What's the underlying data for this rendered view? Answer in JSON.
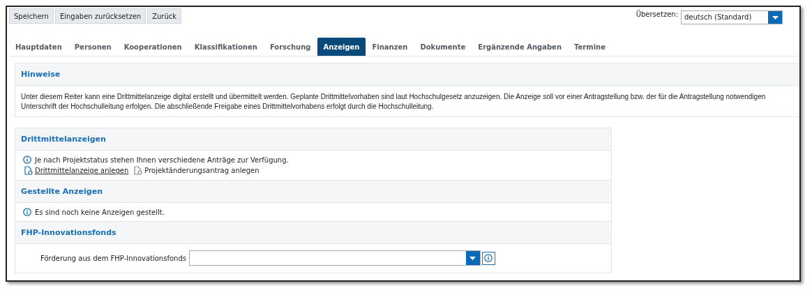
{
  "toolbar": {
    "buttons": [
      "Speichern",
      "Eingaben zurücksetzen",
      "Zurück"
    ]
  },
  "translate": {
    "label": "Übersetzen:",
    "value": "deutsch (Standard)"
  },
  "tabs": [
    {
      "label": "Hauptdaten",
      "selected": false
    },
    {
      "label": "Personen",
      "selected": false
    },
    {
      "label": "Kooperationen",
      "selected": false
    },
    {
      "label": "Klassifikationen",
      "selected": false
    },
    {
      "label": "Forschung",
      "selected": false
    },
    {
      "label": "Anzeigen",
      "selected": true
    },
    {
      "label": "Finanzen",
      "selected": false
    },
    {
      "label": "Dokumente",
      "selected": false
    },
    {
      "label": "Ergänzende Angaben",
      "selected": false
    },
    {
      "label": "Termine",
      "selected": false
    }
  ],
  "notes": {
    "title": "Hinweise",
    "text": "Unter diesem Reiter kann eine Drittmittelanzeige digital erstellt und übermittelt werden. Geplante Drittmittelvorhaben sind laut Hochschulgesetz anzuzeigen. Die Anzeige soll vor einer Antragstellung bzw. der für die Antragstellung notwendigen Unterschrift der Hochschulleitung erfolgen. Die abschließende Freigabe eines Drittmittelvorhabens erfolgt durch die Hochschulleitung."
  },
  "sections": [
    {
      "kind": "actions",
      "title": "Drittmittelanzeigen",
      "info": "Je nach Projektstatus stehen Ihnen verschiedene Anträge zur Verfügung.",
      "links": [
        {
          "label": "Drittmittelanzeige anlegen",
          "disabled": false
        },
        {
          "label": "Projektänderungsantrag anlegen",
          "disabled": true
        }
      ]
    },
    {
      "kind": "info",
      "title": "Gestellte Anzeigen",
      "info": "Es sind noch keine Anzeigen gestellt."
    },
    {
      "kind": "select",
      "title": "FHP-Innovationsfonds",
      "label": "Förderung aus dem FHP-Innovationsfonds"
    }
  ]
}
